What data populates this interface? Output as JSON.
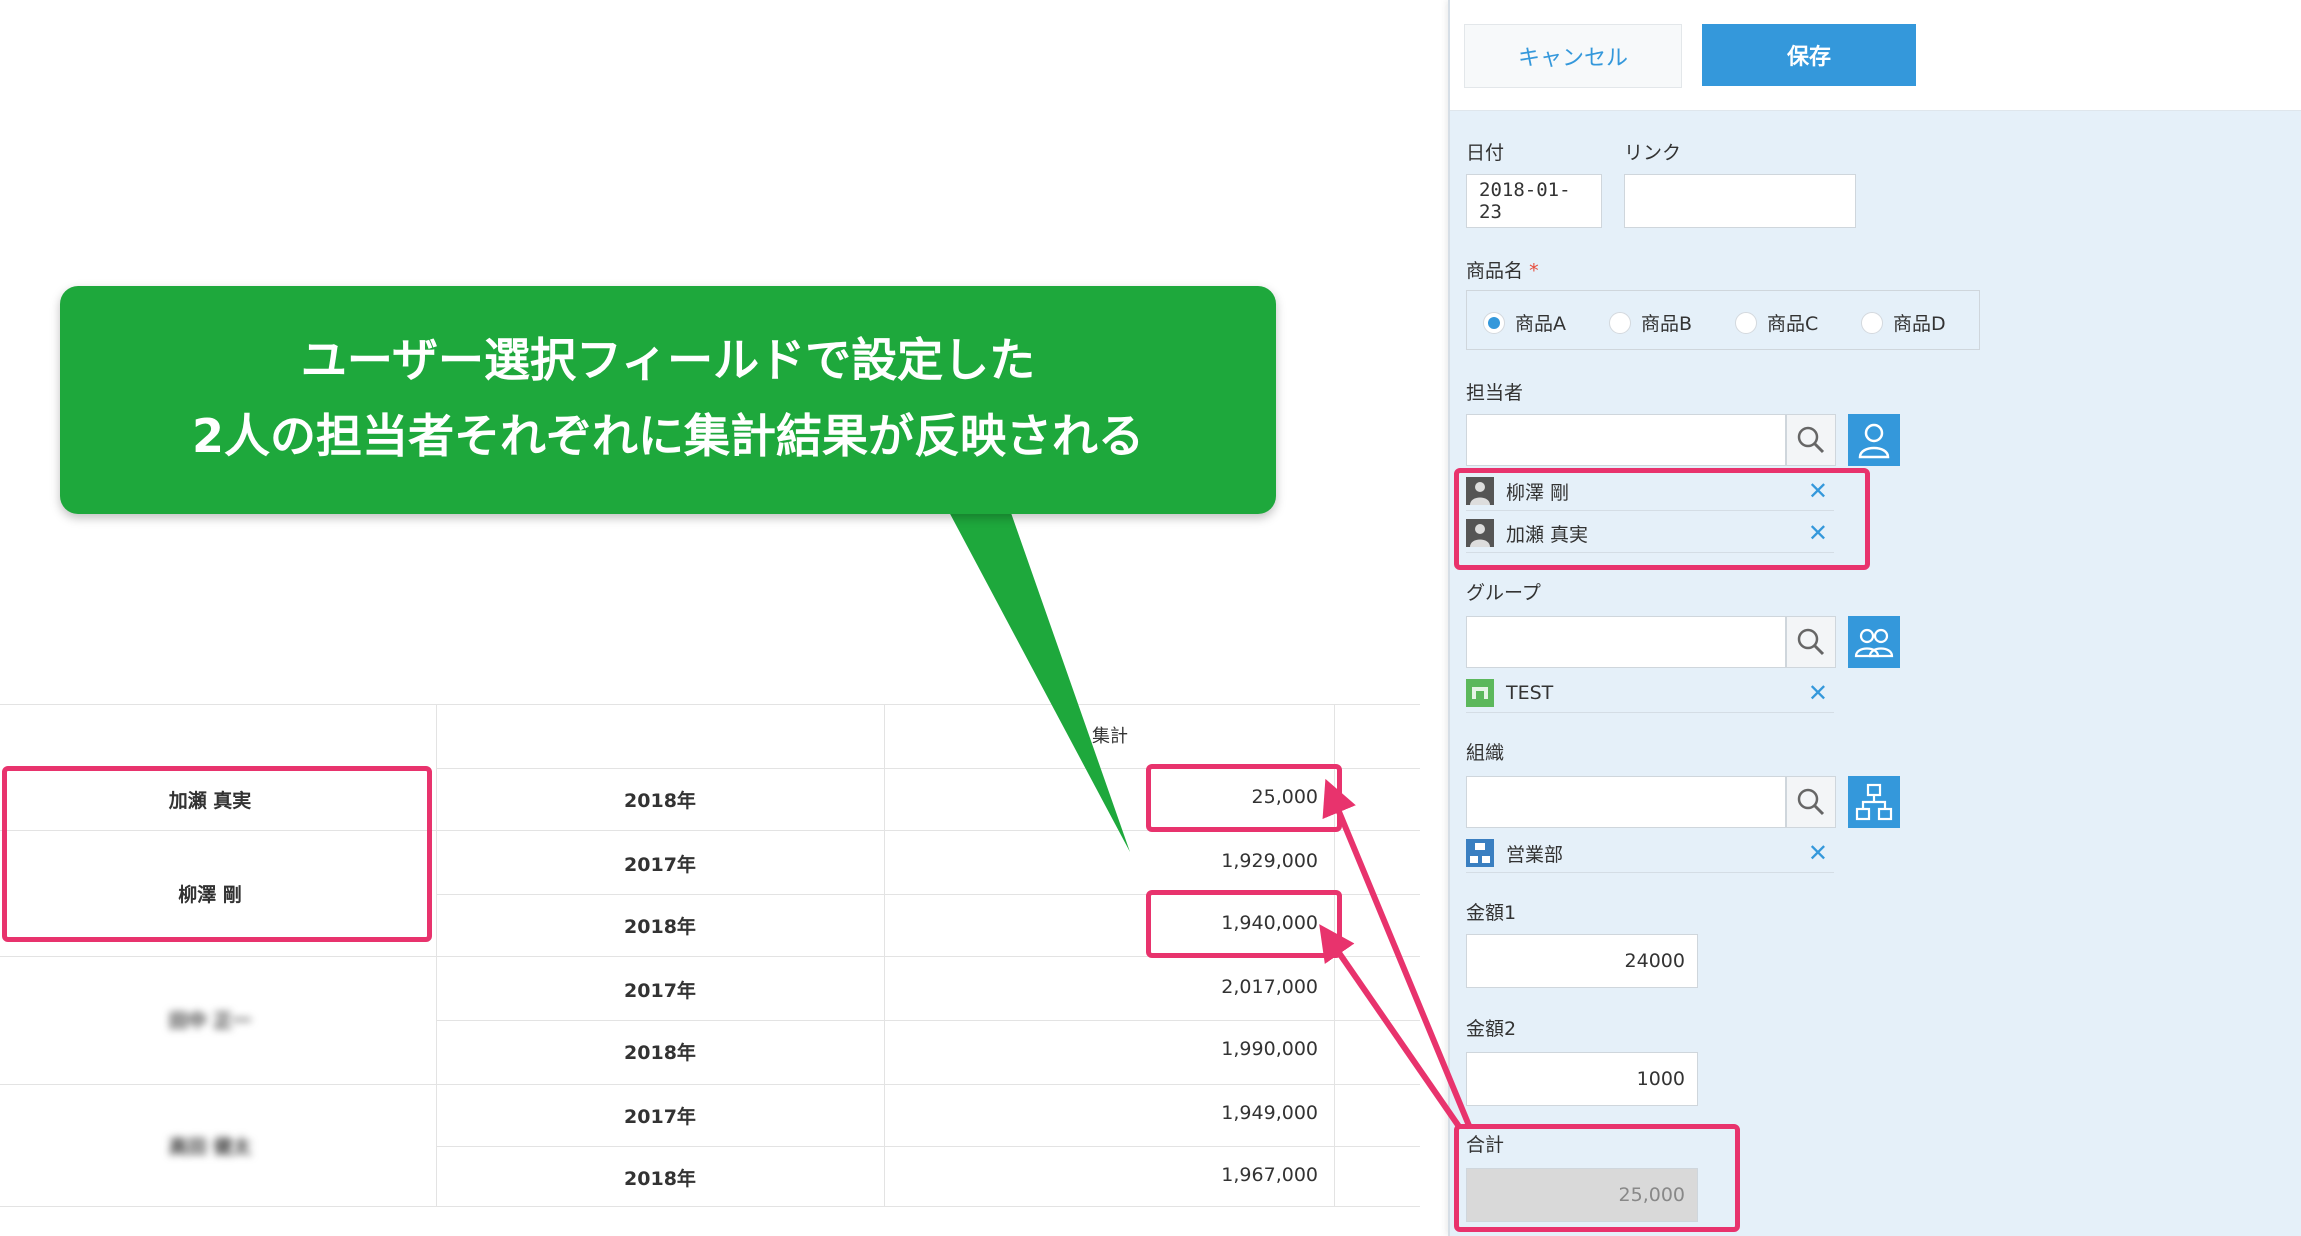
{
  "callout": {
    "line1": "ユーザー選択フィールドで設定した",
    "line2": "2人の担当者それぞれに集計結果が反映される"
  },
  "table": {
    "header": "集計",
    "groups": [
      {
        "name": "加瀬 真実",
        "blurred": false,
        "rows": [
          {
            "year": "2018年",
            "value": "25,000"
          }
        ]
      },
      {
        "name": "柳澤 剛",
        "blurred": false,
        "rows": [
          {
            "year": "2017年",
            "value": "1,929,000"
          },
          {
            "year": "2018年",
            "value": "1,940,000"
          }
        ]
      },
      {
        "name": "田中 正一",
        "blurred": true,
        "rows": [
          {
            "year": "2017年",
            "value": "2,017,000"
          },
          {
            "year": "2018年",
            "value": "1,990,000"
          }
        ]
      },
      {
        "name": "高田 健太",
        "blurred": true,
        "rows": [
          {
            "year": "2017年",
            "value": "1,949,000"
          },
          {
            "year": "2018年",
            "value": "1,967,000"
          }
        ]
      }
    ]
  },
  "form": {
    "cancel_label": "キャンセル",
    "save_label": "保存",
    "date": {
      "label": "日付",
      "value": "2018-01-23"
    },
    "link": {
      "label": "リンク",
      "value": ""
    },
    "product": {
      "label": "商品名",
      "required_mark": "*",
      "options": [
        "商品A",
        "商品B",
        "商品C",
        "商品D"
      ],
      "selected": "商品A"
    },
    "assignee": {
      "label": "担当者",
      "users": [
        "柳澤 剛",
        "加瀬 真実"
      ]
    },
    "group": {
      "label": "グループ",
      "items": [
        "TEST"
      ]
    },
    "org": {
      "label": "組織",
      "items": [
        "営業部"
      ]
    },
    "amount1": {
      "label": "金額1",
      "value": "24000"
    },
    "amount2": {
      "label": "金額2",
      "value": "1000"
    },
    "total": {
      "label": "合計",
      "value": "25,000"
    }
  },
  "colors": {
    "callout": "#1ea83c",
    "highlight": "#e8336d",
    "accent": "#3498db",
    "panel": "#e5f0f9"
  },
  "icons": [
    "search-icon",
    "user-icon",
    "group-icon",
    "org-icon",
    "close-icon"
  ]
}
